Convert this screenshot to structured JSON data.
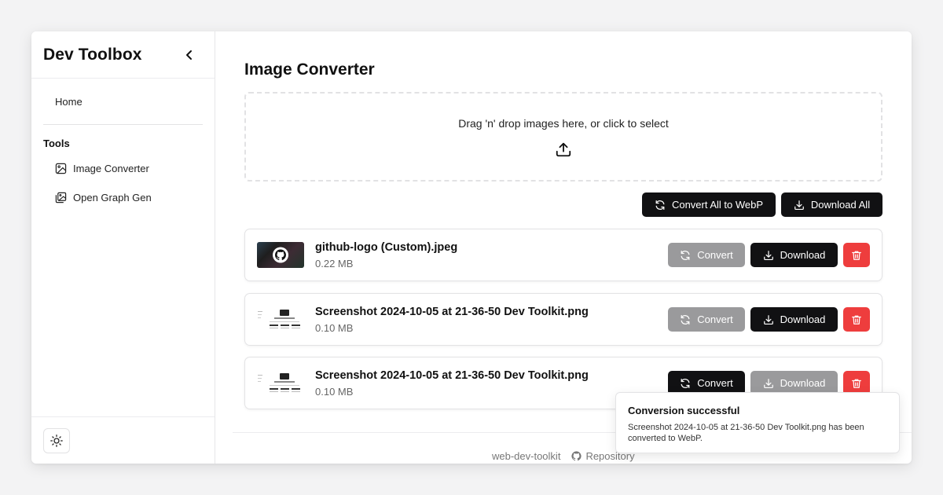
{
  "sidebar": {
    "app_title": "Dev Toolbox",
    "home_label": "Home",
    "section_label": "Tools",
    "items": [
      {
        "label": "Image Converter",
        "icon": "image-icon"
      },
      {
        "label": "Open Graph Gen",
        "icon": "images-icon"
      }
    ]
  },
  "main": {
    "page_title": "Image Converter",
    "dropzone_text": "Drag 'n' drop images here, or click to select",
    "convert_all_label": "Convert All to WebP",
    "download_all_label": "Download All",
    "files": [
      {
        "name": "github-logo (Custom).jpeg",
        "size": "0.22 MB",
        "convert_label": "Convert",
        "download_label": "Download",
        "convert_state": "disabled",
        "download_state": "enabled"
      },
      {
        "name": "Screenshot 2024-10-05 at 21-36-50 Dev Toolkit.png",
        "size": "0.10 MB",
        "convert_label": "Convert",
        "download_label": "Download",
        "convert_state": "disabled",
        "download_state": "enabled"
      },
      {
        "name": "Screenshot 2024-10-05 at 21-36-50 Dev Toolkit.png",
        "size": "0.10 MB",
        "convert_label": "Convert",
        "download_label": "Download",
        "convert_state": "enabled",
        "download_state": "disabled"
      }
    ]
  },
  "footer": {
    "project_name": "web-dev-toolkit",
    "repo_label": "Repository"
  },
  "toast": {
    "title": "Conversion successful",
    "description": "Screenshot 2024-10-05 at 21-36-50 Dev Toolkit.png has been converted to WebP."
  },
  "colors": {
    "primary_dark": "#111113",
    "muted_button": "#9a9a9c",
    "danger": "#ee3d3d"
  }
}
